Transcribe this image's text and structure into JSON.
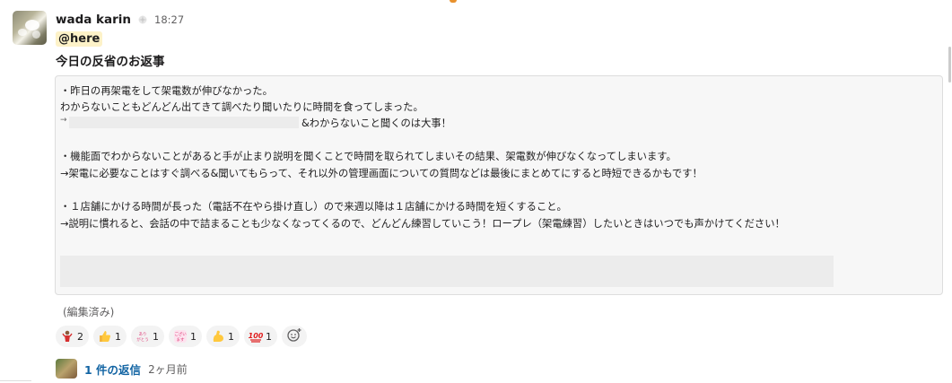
{
  "message": {
    "sender": "wada karin",
    "time": "18:27",
    "mention": "@here",
    "title": "今日の反省のお返事",
    "lines": [
      "・昨日の再架電をして架電数が伸びなかった。",
      "わからないこともどんどん出てきて調べたり聞いたりに時間を食ってしまった。",
      "&わからないこと聞くのは大事！",
      "・機能面でわからないことがあると手が止まり説明を聞くことで時間を取られてしまいその結果、架電数が伸びなくなってしまいます。",
      "→架電に必要なことはすぐ調べる&聞いてもらって、それ以外の管理画面についての質問などは最後にまとめてにすると時短できるかもです！",
      "・１店舗にかける時間が長った（電話不在やら掛け直し）ので来週以降は１店舗にかける時間を短くすること。",
      "→説明に慣れると、会話の中で詰まることも少なくなってくるので、どんどん練習していこう！ロープレ（架電練習）したいときはいつでも声かけてください！"
    ],
    "arrow_prefix": "→",
    "edited": "(編集済み)"
  },
  "reactions": [
    {
      "icon": "celebration-emoji-icon",
      "count": "2"
    },
    {
      "icon": "thumbs-up-icon",
      "count": "1"
    },
    {
      "icon": "arigatou-stamp-icon",
      "stamp_text": "ありがとう",
      "count": "1"
    },
    {
      "icon": "gozaimasu-stamp-icon",
      "stamp_text": "ございます",
      "count": "1"
    },
    {
      "icon": "flexed-biceps-icon",
      "count": "1"
    },
    {
      "icon": "hundred-points-icon",
      "count": "1"
    }
  ],
  "thread": {
    "replies_label": "1 件の返信",
    "last_reply": "2ヶ月前"
  },
  "colors": {
    "link": "#1264a3",
    "mention_bg": "#fdf2c8",
    "quote_bg": "#f7f7f7"
  }
}
